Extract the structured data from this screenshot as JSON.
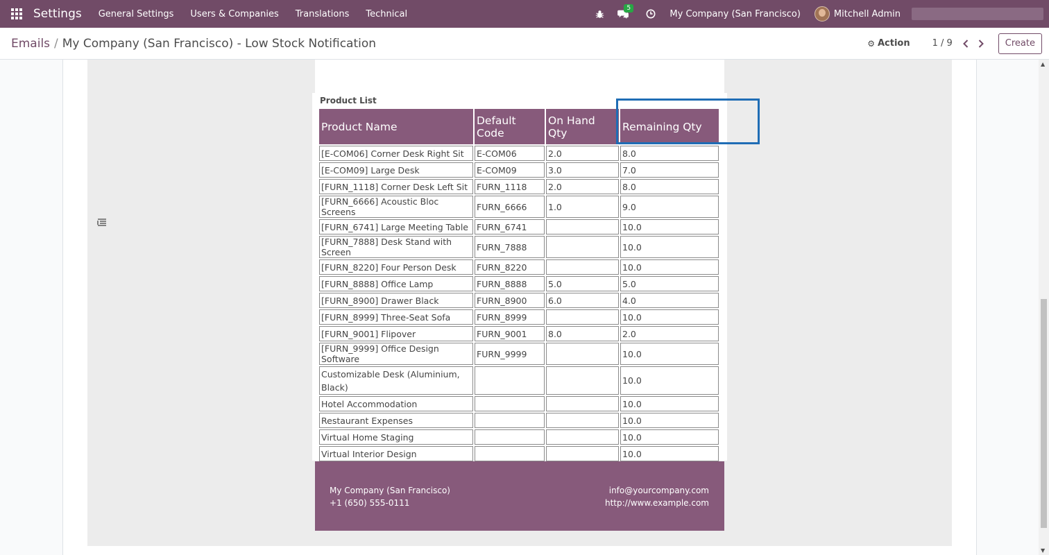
{
  "navbar": {
    "app_name": "Settings",
    "menu": [
      "General Settings",
      "Users & Companies",
      "Translations",
      "Technical"
    ],
    "messages_count": "5",
    "company": "My Company (San Francisco)",
    "user": "Mitchell Admin"
  },
  "control": {
    "breadcrumb_parent": "Emails",
    "breadcrumb_sep": "/",
    "breadcrumb_current": "My Company (San Francisco) - Low Stock Notification",
    "action_label": "Action",
    "pager": "1 / 9",
    "create_label": "Create"
  },
  "email": {
    "section_title": "Product List",
    "columns": [
      "Product Name",
      "Default Code",
      "On Hand Qty",
      "Remaining Qty"
    ],
    "rows": [
      [
        "[E-COM06] Corner Desk Right Sit",
        "E-COM06",
        "2.0",
        "8.0"
      ],
      [
        "[E-COM09] Large Desk",
        "E-COM09",
        "3.0",
        "7.0"
      ],
      [
        "[FURN_1118] Corner Desk Left Sit",
        "FURN_1118",
        "2.0",
        "8.0"
      ],
      [
        "[FURN_6666] Acoustic Bloc Screens",
        "FURN_6666",
        "1.0",
        "9.0"
      ],
      [
        "[FURN_6741] Large Meeting Table",
        "FURN_6741",
        "",
        "10.0"
      ],
      [
        "[FURN_7888] Desk Stand with Screen",
        "FURN_7888",
        "",
        "10.0"
      ],
      [
        "[FURN_8220] Four Person Desk",
        "FURN_8220",
        "",
        "10.0"
      ],
      [
        "[FURN_8888] Office Lamp",
        "FURN_8888",
        "5.0",
        "5.0"
      ],
      [
        "[FURN_8900] Drawer Black",
        "FURN_8900",
        "6.0",
        "4.0"
      ],
      [
        "[FURN_8999] Three-Seat Sofa",
        "FURN_8999",
        "",
        "10.0"
      ],
      [
        "[FURN_9001] Flipover",
        "FURN_9001",
        "8.0",
        "2.0"
      ],
      [
        "[FURN_9999] Office Design Software",
        "FURN_9999",
        "",
        "10.0"
      ],
      [
        "Customizable Desk (Aluminium, Black)",
        "",
        "",
        "10.0"
      ],
      [
        "Hotel Accommodation",
        "",
        "",
        "10.0"
      ],
      [
        "Restaurant Expenses",
        "",
        "",
        "10.0"
      ],
      [
        "Virtual Home Staging",
        "",
        "",
        "10.0"
      ],
      [
        "Virtual Interior Design",
        "",
        "",
        "10.0"
      ]
    ],
    "footer": {
      "company": "My Company (San Francisco)",
      "phone": "+1 (650) 555-0111",
      "email": "info@yourcompany.com",
      "website": "http://www.example.com"
    }
  },
  "colors": {
    "navbar": "#714B67",
    "table_header": "#875A7B",
    "highlight": "#1f6db5"
  }
}
